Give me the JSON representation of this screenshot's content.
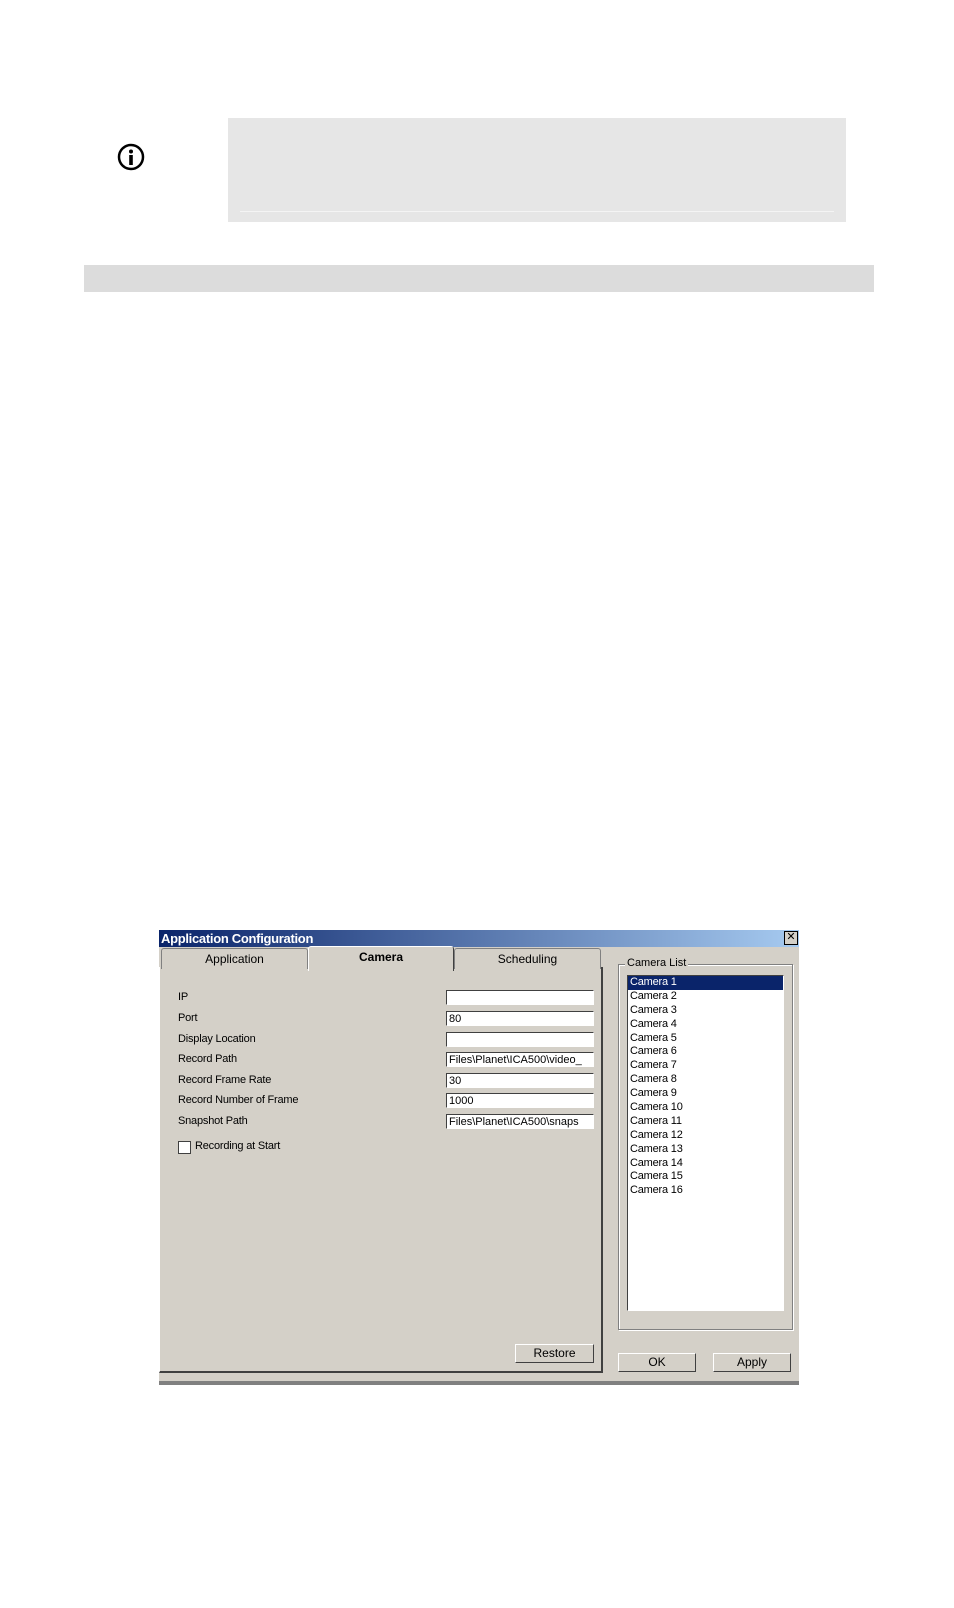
{
  "dialog": {
    "title": "Application Configuration",
    "close_glyph": "✕",
    "tabs": [
      {
        "label": "Application"
      },
      {
        "label": "Camera"
      },
      {
        "label": "Scheduling"
      }
    ],
    "fields": [
      {
        "label": "IP",
        "value": ""
      },
      {
        "label": "Port",
        "value": "80"
      },
      {
        "label": "Display Location",
        "value": ""
      },
      {
        "label": "Record Path",
        "value": "Files\\Planet\\ICA500\\video_"
      },
      {
        "label": "Record Frame Rate",
        "value": "30"
      },
      {
        "label": "Record Number of Frame",
        "value": "1000"
      },
      {
        "label": "Snapshot Path",
        "value": "Files\\Planet\\ICA500\\snaps"
      }
    ],
    "recording_at_start_label": "Recording at Start",
    "recording_at_start_checked": false,
    "restore_label": "Restore",
    "camera_list": {
      "title": "Camera List",
      "items": [
        "Camera 1",
        "Camera 2",
        "Camera 3",
        "Camera 4",
        "Camera 5",
        "Camera 6",
        "Camera 7",
        "Camera 8",
        "Camera 9",
        "Camera 10",
        "Camera 11",
        "Camera 12",
        "Camera 13",
        "Camera 14",
        "Camera 15",
        "Camera 16"
      ],
      "selected": "Camera 1"
    },
    "ok_label": "OK",
    "apply_label": "Apply"
  },
  "icons": {
    "info": "info-icon"
  }
}
